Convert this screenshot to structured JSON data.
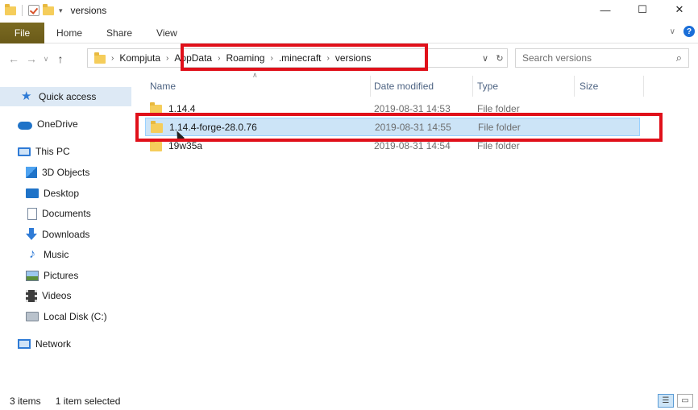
{
  "window": {
    "title": "versions",
    "controls": {
      "minimize": "—",
      "maximize": "☐",
      "close": "✕"
    }
  },
  "ribbon": {
    "tabs": [
      "File",
      "Home",
      "Share",
      "View"
    ],
    "help": "?"
  },
  "address": {
    "crumbs": [
      "Kompjuta",
      "AppData",
      "Roaming",
      ".minecraft",
      "versions"
    ],
    "separator": "›",
    "dropdown": "∨",
    "refresh": "↻"
  },
  "search": {
    "placeholder": "Search versions"
  },
  "nav_buttons": {
    "back": "←",
    "forward": "→",
    "recent": "∨",
    "up": "↑"
  },
  "sidebar": {
    "items": [
      {
        "label": "Quick access",
        "icon": "star-icon"
      },
      {
        "label": "OneDrive",
        "icon": "cloud-icon"
      },
      {
        "label": "This PC",
        "icon": "computer-icon"
      },
      {
        "label": "3D Objects",
        "icon": "cube-icon"
      },
      {
        "label": "Desktop",
        "icon": "desktop-icon"
      },
      {
        "label": "Documents",
        "icon": "document-icon"
      },
      {
        "label": "Downloads",
        "icon": "download-icon"
      },
      {
        "label": "Music",
        "icon": "music-icon"
      },
      {
        "label": "Pictures",
        "icon": "pictures-icon"
      },
      {
        "label": "Videos",
        "icon": "videos-icon"
      },
      {
        "label": "Local Disk (C:)",
        "icon": "disk-icon"
      },
      {
        "label": "Network",
        "icon": "network-icon"
      }
    ]
  },
  "columns": {
    "name": "Name",
    "date": "Date modified",
    "type": "Type",
    "size": "Size"
  },
  "files": [
    {
      "name": "1.14.4",
      "date": "2019-08-31 14:53",
      "type": "File folder",
      "selected": false
    },
    {
      "name": "1.14.4-forge-28.0.76",
      "date": "2019-08-31 14:55",
      "type": "File folder",
      "selected": true
    },
    {
      "name": "19w35a",
      "date": "2019-08-31 14:54",
      "type": "File folder",
      "selected": false
    }
  ],
  "status": {
    "count": "3 items",
    "selection": "1 item selected"
  },
  "colors": {
    "highlight_box": "#e0101a",
    "selected_row": "#cce4f7",
    "file_tab": "#6a5a18"
  }
}
